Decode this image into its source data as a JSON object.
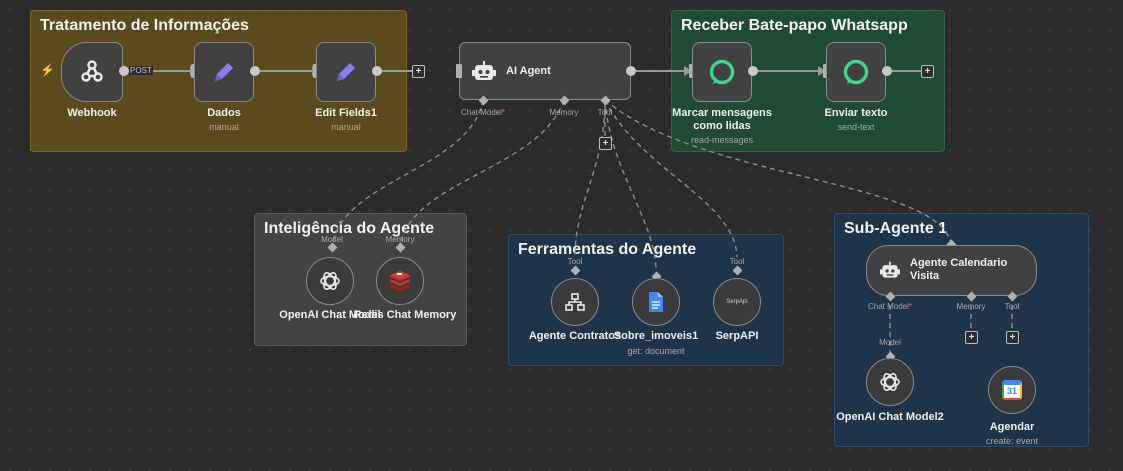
{
  "groups": {
    "tratamento": "Tratamento de Informações",
    "receber": "Receber Bate-papo Whatsapp",
    "inteligencia": "Inteligência do Agente",
    "ferramentas": "Ferramentas do Agente",
    "subagente": "Sub-Agente 1"
  },
  "nodes": {
    "webhook": {
      "name": "Webhook",
      "method": "POST"
    },
    "dados": {
      "name": "Dados",
      "sub": "manual"
    },
    "edit_fields": {
      "name": "Edit Fields1",
      "sub": "manual"
    },
    "ai_agent": {
      "name": "AI Agent"
    },
    "marcar": {
      "name_line1": "Marcar mensagens",
      "name_line2": "como lidas",
      "sub": "read-messages"
    },
    "enviar": {
      "name": "Enviar texto",
      "sub": "send-text"
    },
    "openai_model": {
      "name": "OpenAI Chat Model"
    },
    "redis_memory": {
      "name": "Redis Chat Memory"
    },
    "agente_contratos": {
      "name": "Agente Contratos"
    },
    "sobre_imoveis": {
      "name": "Sobre_imoveis1",
      "sub": "get: document"
    },
    "serpapi": {
      "name": "SerpAPI",
      "icon_text": "SerpApi"
    },
    "agente_calendario": {
      "name_line1": "Agente Calendario",
      "name_line2": "Visita"
    },
    "openai_model2": {
      "name": "OpenAI Chat Model2"
    },
    "agendar": {
      "name": "Agendar",
      "sub": "create: event",
      "icon_text": "31"
    }
  },
  "ports": {
    "chat_model": "Chat Model",
    "chat_model_required": "*",
    "memory": "Memory",
    "tool": "Tool",
    "model": "Model"
  },
  "plus": "+",
  "colors": {
    "tratamento_bg": "#5a4a1e",
    "receber_bg": "#1f4a33",
    "inteligencia_bg": "#434343",
    "blue_bg": "#1e3449",
    "accent_purple": "#8b7ff0",
    "whatsapp_green": "#3dd68c",
    "trigger_orange": "#ff6b4a"
  }
}
